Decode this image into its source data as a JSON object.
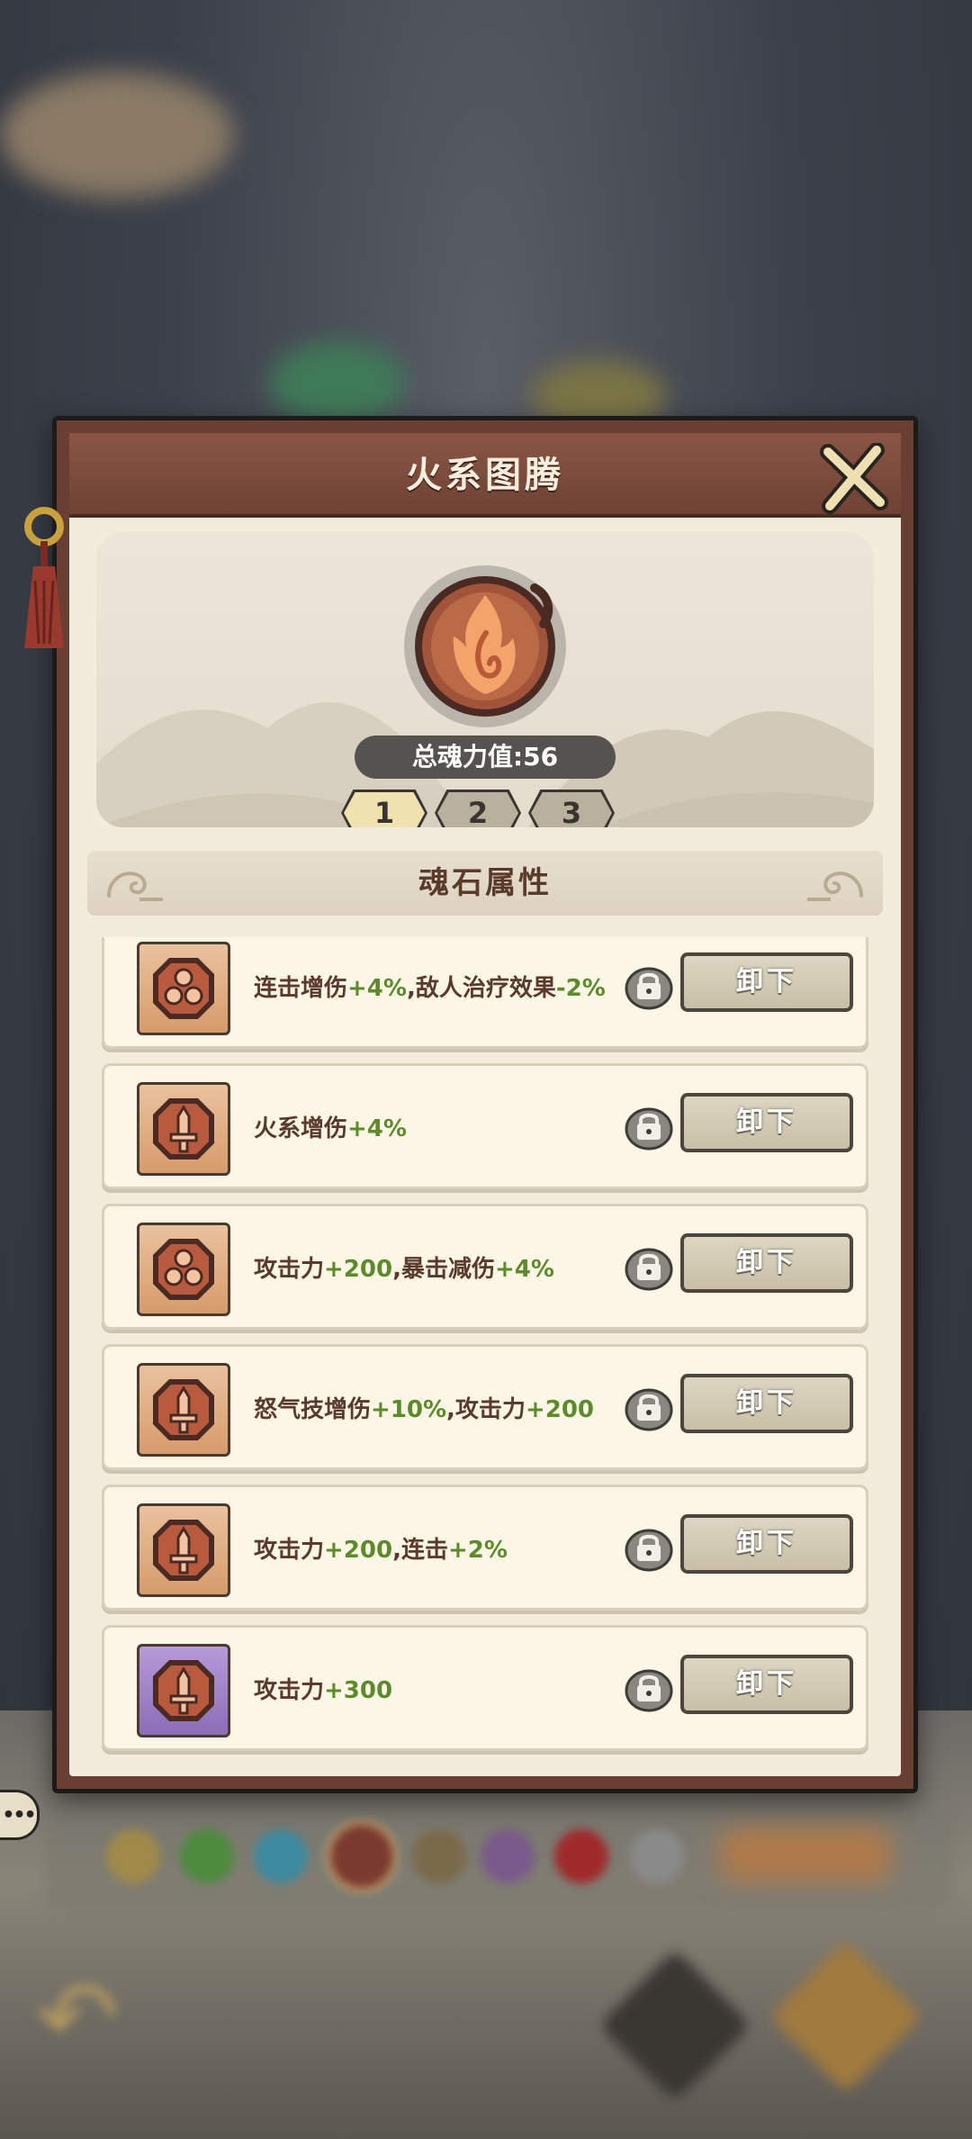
{
  "modal": {
    "title": "火系图腾",
    "soul_power_label": "总魂力值:56",
    "tabs": [
      {
        "label": "1",
        "active": true
      },
      {
        "label": "2",
        "active": false
      },
      {
        "label": "3",
        "active": false
      }
    ],
    "section_title": "魂石属性"
  },
  "soul_stones": [
    {
      "icon": "triple-orb-stone-icon",
      "rarity": "orange",
      "text": "连击增伤",
      "parts": [
        [
          "连击增伤",
          ""
        ],
        [
          "+4%",
          "plus"
        ],
        [
          ",敌人治疗效果",
          ""
        ],
        [
          "-2%",
          "plus"
        ]
      ],
      "button": "卸下"
    },
    {
      "icon": "sword-stone-icon",
      "rarity": "orange",
      "parts": [
        [
          "火系增伤",
          ""
        ],
        [
          "+4%",
          "plus"
        ]
      ],
      "button": "卸下"
    },
    {
      "icon": "triple-orb-stone-icon",
      "rarity": "orange",
      "parts": [
        [
          "攻击力",
          ""
        ],
        [
          "+200",
          "plus"
        ],
        [
          ",暴击减伤",
          ""
        ],
        [
          "+4%",
          "plus"
        ]
      ],
      "button": "卸下"
    },
    {
      "icon": "sword-stone-icon",
      "rarity": "orange",
      "parts": [
        [
          "怒气技增伤",
          ""
        ],
        [
          "+10%",
          "plus"
        ],
        [
          ",攻击力",
          ""
        ],
        [
          "+200",
          "plus"
        ]
      ],
      "button": "卸下"
    },
    {
      "icon": "sword-stone-icon",
      "rarity": "orange",
      "parts": [
        [
          "攻击力",
          ""
        ],
        [
          "+200",
          "plus"
        ],
        [
          ",连击",
          ""
        ],
        [
          "+2%",
          "plus"
        ]
      ],
      "button": "卸下"
    },
    {
      "icon": "sword-stone-icon",
      "rarity": "purple",
      "parts": [
        [
          "攻击力",
          ""
        ],
        [
          "+300",
          "plus"
        ]
      ],
      "button": "卸下"
    }
  ],
  "colors": {
    "title_bar": "#6e4234",
    "panel_bg": "#f3ebdb",
    "bonus_green": "#5d8b2c",
    "stone_orange": "#d79b6b",
    "stone_purple": "#8b6db8"
  }
}
